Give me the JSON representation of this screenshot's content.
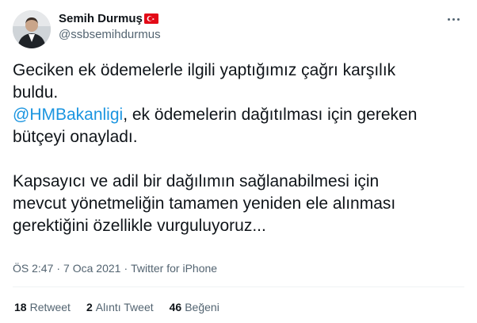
{
  "user": {
    "display_name": "Semih Durmuş",
    "handle": "@ssbsemihdurmus",
    "flag_icon": "turkey-flag-icon"
  },
  "tweet": {
    "lines": [
      "Geciken ek ödemelerle ilgili yaptığımız çağrı karşılık",
      "buldu."
    ],
    "mention": "@HMBakanligi",
    "mention_rest_1": ", ek ödemelerin dağıtılması için gereken",
    "mention_rest_2": "bütçeyi onayladı.",
    "para3": [
      "Kapsayıcı ve adil bir dağılımın sağlanabilmesi için",
      "mevcut yönetmeliğin tamamen yeniden ele alınması",
      "gerektiğini özellikle vurguluyoruz..."
    ]
  },
  "meta": {
    "time": "ÖS 2:47",
    "date": "7 Oca 2021",
    "separator": "·",
    "source": "Twitter for iPhone"
  },
  "stats": {
    "retweets_count": "18",
    "retweets_label": "Retweet",
    "quotes_count": "2",
    "quotes_label": "Alıntı Tweet",
    "likes_count": "46",
    "likes_label": "Beğeni"
  },
  "colors": {
    "mention": "#1b95e0",
    "secondary_text": "#536471",
    "divider": "#eff3f4",
    "flag_red": "#e30a17"
  }
}
